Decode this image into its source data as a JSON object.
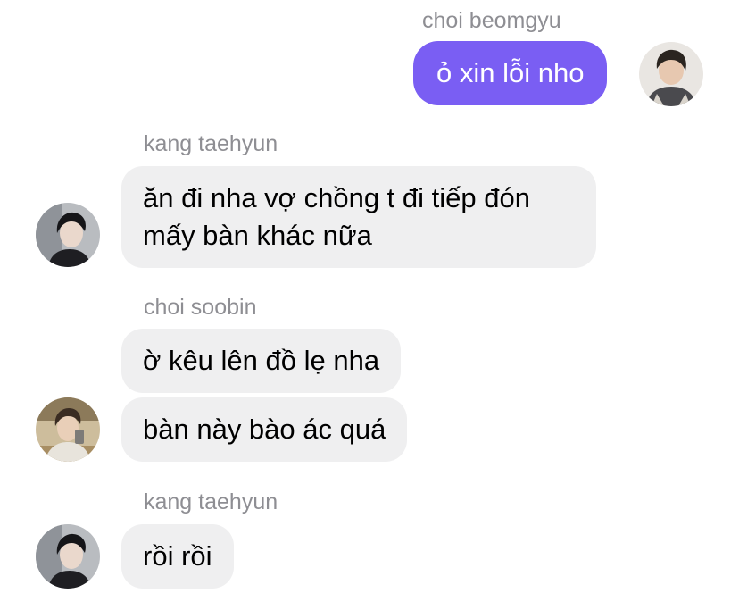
{
  "messages": [
    {
      "sender": "choi beomgyu",
      "direction": "outgoing",
      "avatar_icon": "profile-photo-beomgyu",
      "bubbles": [
        "ỏ xin lỗi nho"
      ]
    },
    {
      "sender": "kang taehyun",
      "direction": "incoming",
      "avatar_icon": "profile-photo-taehyun",
      "bubbles": [
        "ăn đi nha vợ chồng t đi tiếp đón\nmấy bàn khác nữa"
      ]
    },
    {
      "sender": "choi soobin",
      "direction": "incoming",
      "avatar_icon": "profile-photo-soobin",
      "bubbles": [
        "ờ kêu lên đồ lẹ nha",
        "bàn này bào ác quá"
      ]
    },
    {
      "sender": "kang taehyun",
      "direction": "incoming",
      "avatar_icon": "profile-photo-taehyun",
      "bubbles": [
        "rồi rồi"
      ]
    }
  ],
  "colors": {
    "outgoing_bubble": "#7a5ef3",
    "incoming_bubble": "#efeff0",
    "sender_name": "#8e8e93"
  }
}
